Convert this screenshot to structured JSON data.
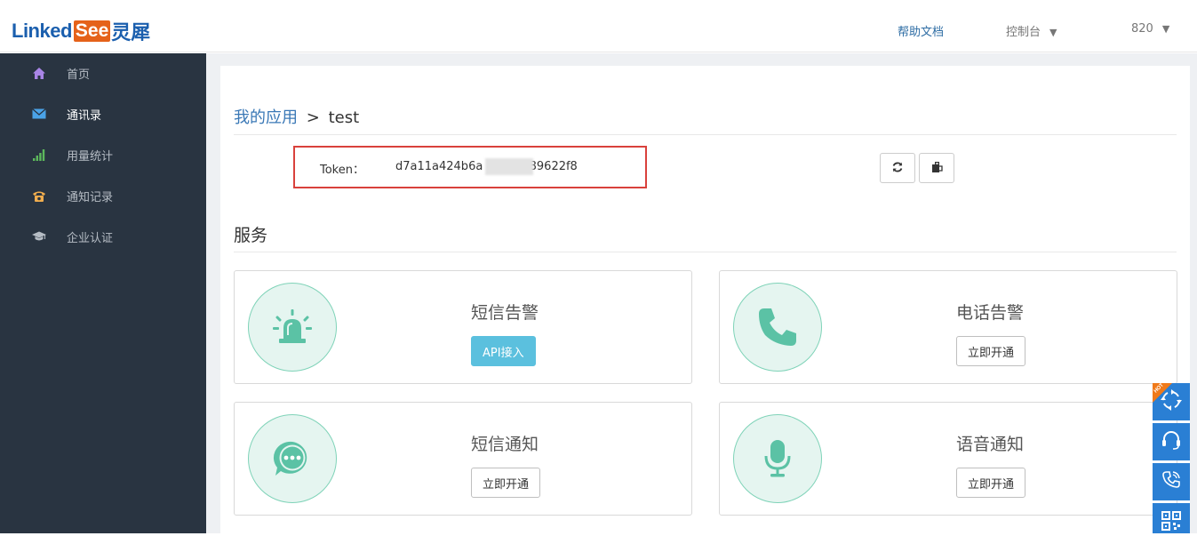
{
  "header": {
    "logo_linked": "Linked",
    "logo_see": "See",
    "logo_cn": "灵犀",
    "help": "帮助文档",
    "console": "控制台",
    "user": "820",
    "caret": "▼"
  },
  "sidebar": {
    "items": [
      {
        "label": "首页",
        "icon": "home-icon",
        "color": "#a985e6"
      },
      {
        "label": "通讯录",
        "icon": "envelope-icon",
        "color": "#4aa3e8",
        "active": true
      },
      {
        "label": "用量统计",
        "icon": "signal-bars-icon",
        "color": "#5cb85c"
      },
      {
        "label": "通知记录",
        "icon": "phone-icon",
        "color": "#f0ad4e"
      },
      {
        "label": "企业认证",
        "icon": "graduation-cap-icon",
        "color": "#b6bdc5"
      }
    ]
  },
  "main": {
    "breadcrumb_link": "我的应用",
    "breadcrumb_sep": ">",
    "breadcrumb_current": "test",
    "token_label": "Token：",
    "token_value": "d7a11a424b6a          48c3a389622f8",
    "refresh_icon": "refresh-icon",
    "copy_icon": "copy-icon",
    "section_title": "服务",
    "services": [
      {
        "title": "短信告警",
        "button": "API接入",
        "icon": "alarm-light-icon",
        "primary": true
      },
      {
        "title": "电话告警",
        "button": "立即开通",
        "icon": "phone-handset-icon"
      },
      {
        "title": "短信通知",
        "button": "立即开通",
        "icon": "chat-bubble-icon"
      },
      {
        "title": "语音通知",
        "button": "立即开通",
        "icon": "microphone-icon"
      }
    ]
  },
  "float_bar": {
    "hot": "HOT",
    "buttons": [
      "cycle-icon",
      "headset-icon",
      "call-icon",
      "qrcode-icon"
    ]
  },
  "colors": {
    "sidebar_bg": "#293441",
    "accent_green": "#5bc2a5",
    "primary_button": "#5bc0de",
    "float_blue": "#2a7fd4",
    "highlight_red": "#d9413c"
  }
}
